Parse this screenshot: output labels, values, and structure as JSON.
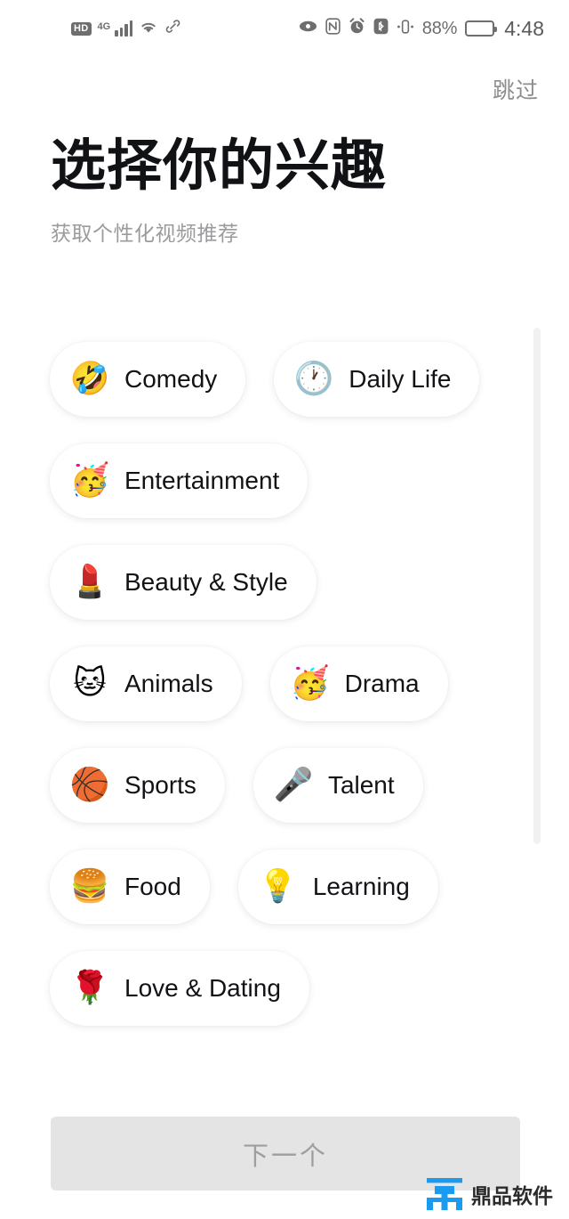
{
  "status_bar": {
    "hd_badge": "HD",
    "network_type": "4G",
    "signal_icon": "signal-bars-icon",
    "wifi_icon": "wifi-icon",
    "link_icon": "link-icon",
    "eye_icon": "eye-icon",
    "nfc_icon": "nfc-icon",
    "alarm_icon": "alarm-clock-icon",
    "bluetooth_icon": "bluetooth-icon",
    "vibrate_icon": "vibrate-icon",
    "battery_percent": "88%",
    "battery_level": 88,
    "battery_icon": "battery-icon",
    "time": "4:48"
  },
  "header": {
    "skip_label": "跳过",
    "title": "选择你的兴趣",
    "subtitle": "获取个性化视频推荐"
  },
  "interests": [
    {
      "label": "Comedy",
      "emoji": "🤣",
      "icon_name": "rolling-on-floor-laughing-emoji",
      "selected": false
    },
    {
      "label": "Daily Life",
      "emoji": "🕐",
      "icon_name": "clock-emoji",
      "selected": false
    },
    {
      "label": "Entertainment",
      "emoji": "🥳",
      "icon_name": "partying-face-emoji",
      "selected": false
    },
    {
      "label": "Beauty & Style",
      "emoji": "💄",
      "icon_name": "lipstick-emoji",
      "selected": false
    },
    {
      "label": "Animals",
      "emoji": "🐱",
      "icon_name": "cat-face-emoji",
      "selected": false
    },
    {
      "label": "Drama",
      "emoji": "🥳",
      "icon_name": "partying-face-emoji",
      "selected": false
    },
    {
      "label": "Sports",
      "emoji": "🏀",
      "icon_name": "basketball-emoji",
      "selected": false
    },
    {
      "label": "Talent",
      "emoji": "🎤",
      "icon_name": "studio-microphone-emoji",
      "selected": false
    },
    {
      "label": "Food",
      "emoji": "🍔",
      "icon_name": "hamburger-emoji",
      "selected": false
    },
    {
      "label": "Learning",
      "emoji": "💡",
      "icon_name": "light-bulb-emoji",
      "selected": false
    },
    {
      "label": "Love & Dating",
      "emoji": "🌹",
      "icon_name": "rose-emoji",
      "selected": false
    }
  ],
  "footer": {
    "next_label": "下一个",
    "next_enabled": false
  },
  "watermark": {
    "text": "鼎品软件",
    "logo_color": "#1a9bf0"
  },
  "colors": {
    "background": "#ffffff",
    "title_text": "#111215",
    "subtitle_text": "#9b9b9e",
    "chip_bg": "#ffffff",
    "chip_text": "#111215",
    "button_disabled_bg": "#e4e4e4",
    "button_disabled_text": "#9e9e9e",
    "scrollbar": "#f1f1f1",
    "status_icon": "#6e6e6e"
  }
}
